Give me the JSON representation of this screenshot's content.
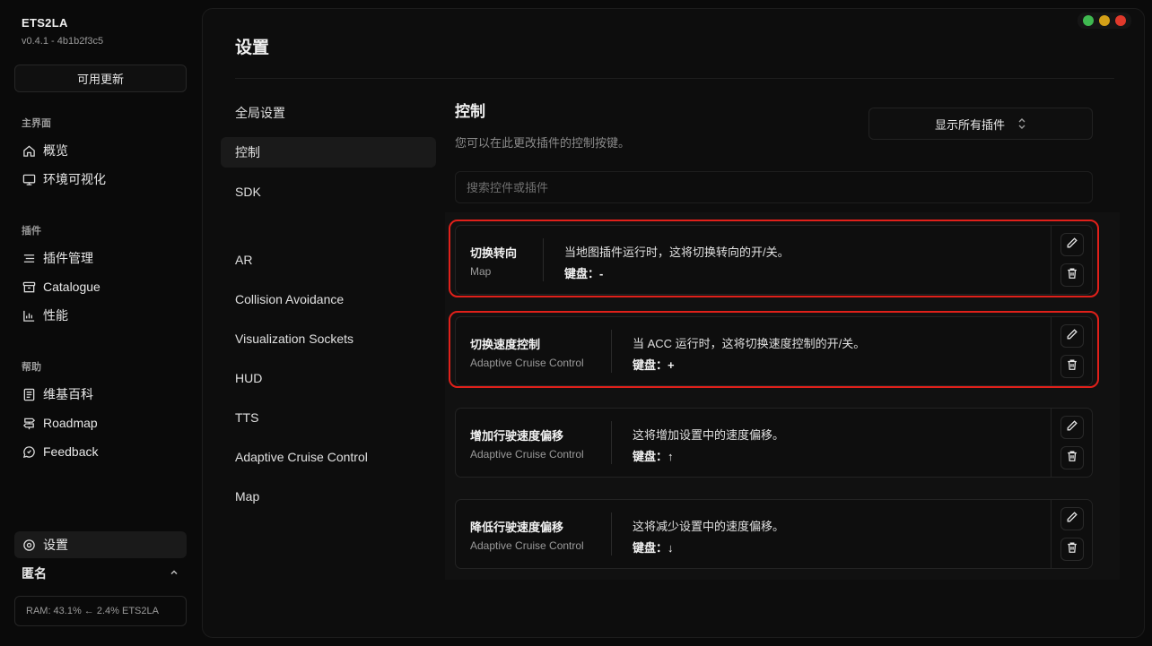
{
  "app": {
    "title": "ETS2LA",
    "version": "v0.4.1 - 4b1b2f3c5",
    "update_label": "可用更新"
  },
  "sidebar": {
    "groups": [
      {
        "title": "主界面",
        "items": [
          {
            "label": "概览",
            "icon": "home-icon"
          },
          {
            "label": "环境可视化",
            "icon": "monitor-icon"
          }
        ]
      },
      {
        "title": "插件",
        "items": [
          {
            "label": "插件管理",
            "icon": "list-icon"
          },
          {
            "label": "Catalogue",
            "icon": "archive-icon"
          },
          {
            "label": "性能",
            "icon": "chart-icon"
          }
        ]
      },
      {
        "title": "帮助",
        "items": [
          {
            "label": "维基百科",
            "icon": "book-icon"
          },
          {
            "label": "Roadmap",
            "icon": "signpost-icon"
          },
          {
            "label": "Feedback",
            "icon": "message-icon"
          }
        ]
      }
    ],
    "settings_label": "设置",
    "user_label": "匿名",
    "ram_status": "RAM: 43.1% ← 2.4% ETS2LA"
  },
  "page": {
    "title": "设置"
  },
  "settings_nav": [
    {
      "label": "全局设置",
      "active": false
    },
    {
      "label": "控制",
      "active": true
    },
    {
      "label": "SDK",
      "active": false
    },
    {
      "label": "AR",
      "active": false
    },
    {
      "label": "Collision Avoidance",
      "active": false
    },
    {
      "label": "Visualization Sockets",
      "active": false
    },
    {
      "label": "HUD",
      "active": false
    },
    {
      "label": "TTS",
      "active": false
    },
    {
      "label": "Adaptive Cruise Control",
      "active": false
    },
    {
      "label": "Map",
      "active": false
    }
  ],
  "controls": {
    "title": "控制",
    "description": "您可以在此更改插件的控制按键。",
    "filter_label": "显示所有插件",
    "search_placeholder": "搜索控件或插件",
    "search_value": "",
    "items": [
      {
        "name": "切换转向",
        "plugin": "Map",
        "description": "当地图插件运行时，这将切换转向的开/关。",
        "keybind": "键盘：-",
        "highlighted": true
      },
      {
        "name": "切换速度控制",
        "plugin": "Adaptive Cruise Control",
        "description": "当 ACC 运行时，这将切换速度控制的开/关。",
        "keybind": "键盘：+",
        "highlighted": true
      },
      {
        "name": "增加行驶速度偏移",
        "plugin": "Adaptive Cruise Control",
        "description": "这将增加设置中的速度偏移。",
        "keybind": "键盘：↑",
        "highlighted": false
      },
      {
        "name": "降低行驶速度偏移",
        "plugin": "Adaptive Cruise Control",
        "description": "这将减少设置中的速度偏移。",
        "keybind": "键盘：↓",
        "highlighted": false
      }
    ]
  },
  "colors": {
    "highlight": "#e0201a",
    "window_close": "#3fb950",
    "window_minimize": "#d4a017",
    "window_maximize": "#e0392b"
  }
}
